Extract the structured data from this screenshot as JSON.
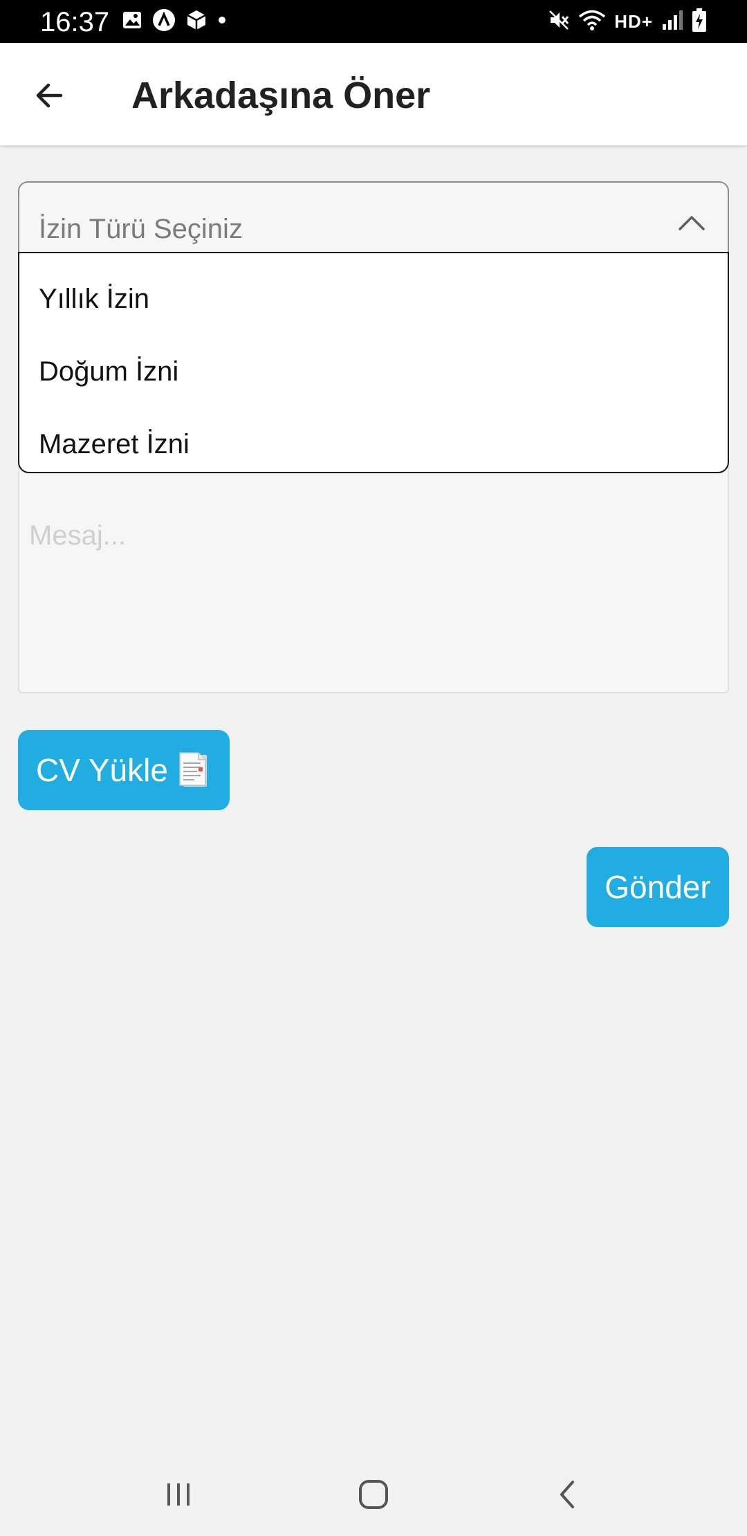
{
  "status_bar": {
    "time": "16:37",
    "network_label": "HD+",
    "left_icons": [
      "image-icon",
      "app-circle-icon",
      "package-icon",
      "dot-icon"
    ],
    "right_icons": [
      "mute-icon",
      "wifi-icon",
      "signal-icon",
      "battery-charging-icon"
    ]
  },
  "app_bar": {
    "title": "Arkadaşına Öner",
    "back_icon": "arrow-left-icon"
  },
  "form": {
    "select": {
      "placeholder": "İzin Türü Seçiniz",
      "expanded": true,
      "options": [
        "Yıllık İzin",
        "Doğum İzni",
        "Mazeret İzni"
      ]
    },
    "message": {
      "placeholder": "Mesaj...",
      "value": ""
    },
    "cv_button": {
      "label": "CV Yükle",
      "icon": "document-icon"
    },
    "send_button": {
      "label": "Gönder"
    }
  },
  "nav_bar": {
    "items": [
      "recent-apps-icon",
      "home-icon",
      "back-icon"
    ]
  },
  "colors": {
    "accent": "#22ade2",
    "background": "#f1f1f1",
    "status_bar": "#000000"
  }
}
